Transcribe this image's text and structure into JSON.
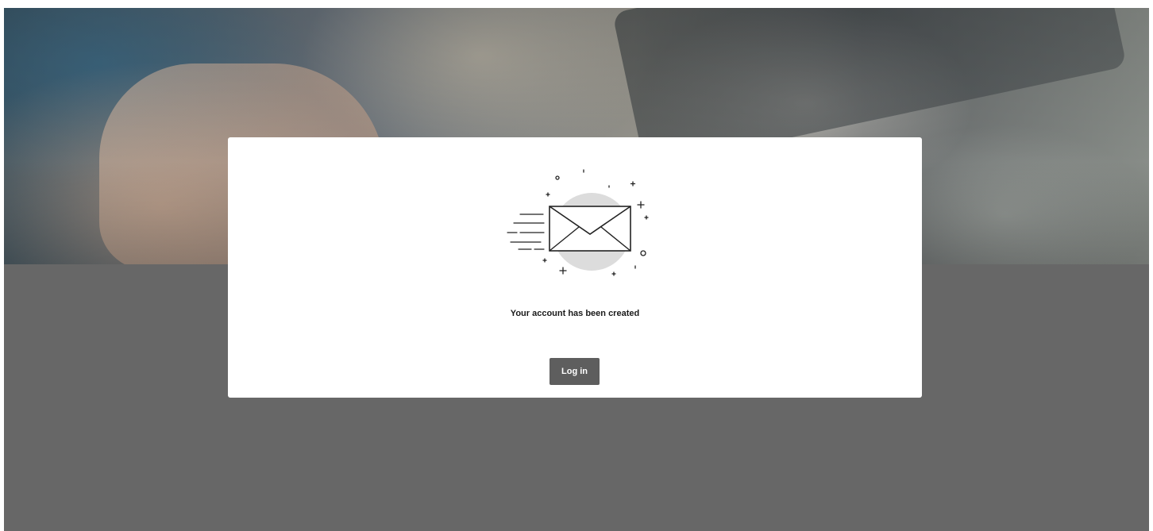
{
  "confirmation": {
    "message": "Your account has been created",
    "login_label": "Log in",
    "illustration_icon": "envelope-sent-icon"
  },
  "colors": {
    "page_background": "#676767",
    "card_background": "#ffffff",
    "button_background": "#5e5e5e",
    "button_text": "#ffffff",
    "illustration_circle": "#dcdcdc"
  }
}
